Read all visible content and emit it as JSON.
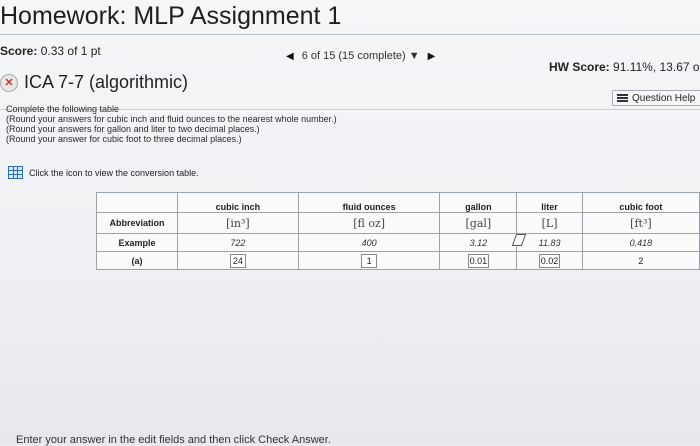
{
  "header": {
    "title": "Homework: MLP Assignment 1",
    "score_label": "Score:",
    "score_value": "0.33 of 1 pt",
    "nav_progress": "6 of 15 (15 complete)",
    "hw_label": "HW Score:",
    "hw_value": "91.11%, 13.67 o"
  },
  "question": {
    "name": "ICA 7-7 (algorithmic)",
    "help_label": "Question Help",
    "instructions": [
      "Complete the following table",
      "(Round your answers for cubic inch and fluid ounces to the nearest whole number.)",
      "(Round your answers for gallon and liter to two decimal places.)",
      "(Round your answer for cubic foot to three decimal places.)"
    ],
    "conversion_link": "Click the icon to view the conversion table."
  },
  "table": {
    "headers": [
      "",
      "cubic inch",
      "fluid ounces",
      "gallon",
      "liter",
      "cubic foot"
    ],
    "abbr_row": {
      "label": "Abbreviation",
      "symbols": [
        "[in³]",
        "[fl oz]",
        "[gal]",
        "[L]",
        "[ft³]"
      ]
    },
    "example_row": {
      "label": "Example",
      "values": [
        "722",
        "400",
        "3.12",
        "11.83",
        "0.418"
      ]
    },
    "a_row": {
      "label": "(a)",
      "values": [
        "24",
        "1",
        "0.01",
        "0.02",
        "2"
      ]
    }
  },
  "footer": {
    "text": "Enter your answer in the edit fields and then click Check Answer."
  }
}
